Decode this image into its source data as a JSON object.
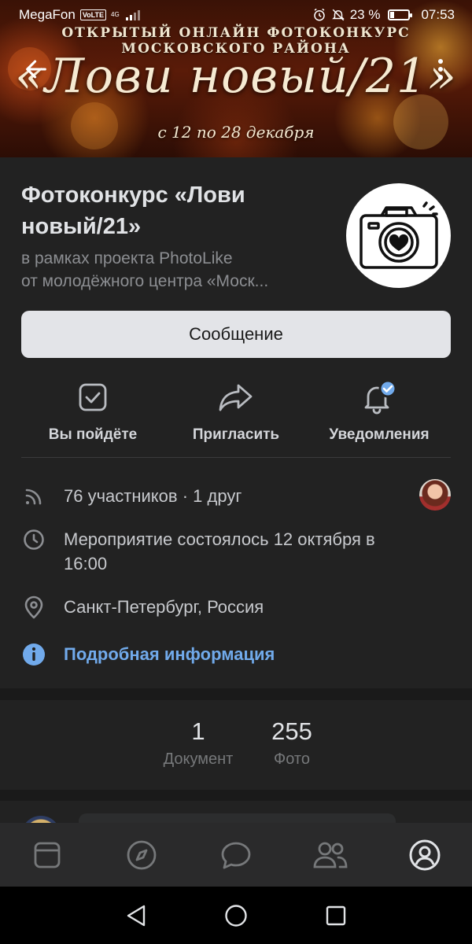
{
  "status_bar": {
    "carrier": "MegaFon",
    "volte": "VoLTE",
    "network": "4G",
    "battery": "23 %",
    "time": "07:53"
  },
  "banner": {
    "top_text": "ОТКРЫТЫЙ ОНЛАЙН ФОТОКОНКУРС МОСКОВСКОГО РАЙОНА",
    "title": "«Лови новый/21»",
    "subtitle": "с 12 по 28 декабря"
  },
  "event": {
    "title": "Фотоконкурс «Лови новый/21»",
    "subtitle_lines": [
      "в рамках проекта PhotoLike",
      "от молодёжного центра «Моск..."
    ],
    "message_button": "Сообщение",
    "actions": [
      {
        "label": "Вы пойдёте",
        "icon": "checkbox-icon"
      },
      {
        "label": "Пригласить",
        "icon": "share-arrow-icon"
      },
      {
        "label": "Уведомления",
        "icon": "bell-icon"
      }
    ],
    "members": "76 участников · 1 друг",
    "date_line1": "Мероприятие состоялось 12 октября в",
    "date_line2": "16:00",
    "location": "Санкт-Петербург, Россия",
    "details_link": "Подробная информация"
  },
  "counters": [
    {
      "value": "1",
      "label": "Документ"
    },
    {
      "value": "255",
      "label": "Фото"
    }
  ],
  "tabs": [
    {
      "icon": "news-icon"
    },
    {
      "icon": "compass-icon"
    },
    {
      "icon": "messages-icon"
    },
    {
      "icon": "friends-icon"
    },
    {
      "icon": "profile-icon"
    }
  ],
  "colors": {
    "background": "#1a1a1a",
    "card": "#222222",
    "accent": "#71aaeb",
    "button": "#e3e4e8"
  }
}
